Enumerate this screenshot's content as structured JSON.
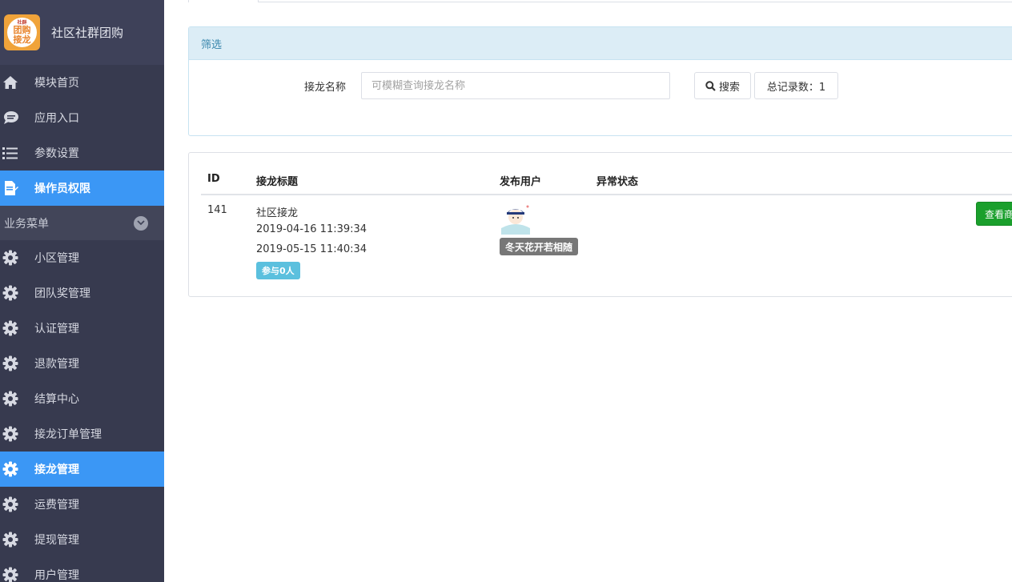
{
  "brand": {
    "title": "社区社群团购",
    "logo_text_top": "社群",
    "logo_text_mid": "团购",
    "logo_text_bottom": "接龙"
  },
  "sidebar": {
    "top_items": [
      {
        "label": "模块首页",
        "icon": "home-icon"
      },
      {
        "label": "应用入口",
        "icon": "chat-icon"
      },
      {
        "label": "参数设置",
        "icon": "list-icon"
      },
      {
        "label": "操作员权限",
        "icon": "document-edit-icon",
        "active": true
      }
    ],
    "section_title": "业务菜单",
    "section_items": [
      {
        "label": "小区管理",
        "icon": "gear-icon"
      },
      {
        "label": "团队奖管理",
        "icon": "gear-icon"
      },
      {
        "label": "认证管理",
        "icon": "gear-icon"
      },
      {
        "label": "退款管理",
        "icon": "gear-icon"
      },
      {
        "label": "结算中心",
        "icon": "gear-icon"
      },
      {
        "label": "接龙订单管理",
        "icon": "gear-icon"
      },
      {
        "label": "接龙管理",
        "icon": "gear-icon",
        "active": true
      },
      {
        "label": "运费管理",
        "icon": "gear-icon"
      },
      {
        "label": "提现管理",
        "icon": "gear-icon"
      },
      {
        "label": "用户管理",
        "icon": "gear-icon"
      }
    ],
    "active_color": "#3b97f5",
    "background_color": "#373a4f"
  },
  "filter": {
    "title": "筛选",
    "name_label": "接龙名称",
    "name_placeholder": "可模糊查询接龙名称",
    "name_value": "",
    "search_label": "搜索",
    "count_label": "总记录数：1"
  },
  "table": {
    "columns": [
      "ID",
      "接龙标题",
      "发布用户",
      "异常状态"
    ],
    "rows": [
      {
        "id": "141",
        "title": "社区接龙",
        "start_time": "2019-04-16 11:39:34",
        "end_time": "2019-05-15 11:40:34",
        "participants": "参与0人",
        "user": "冬天花开若相随",
        "status": "",
        "action_label": "查看商品"
      }
    ]
  }
}
